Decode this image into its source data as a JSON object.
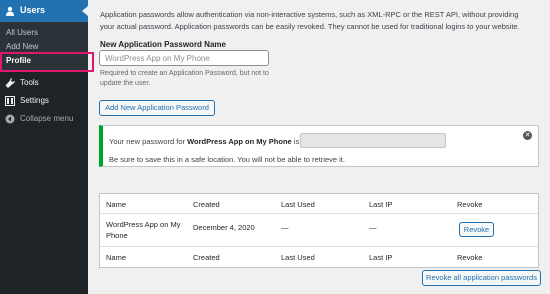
{
  "sidebar": {
    "users_label": "Users",
    "submenu": [
      "All Users",
      "Add New",
      "Profile"
    ],
    "tools_label": "Tools",
    "settings_label": "Settings",
    "collapse_label": "Collapse menu"
  },
  "intro_text": "Application passwords allow authentication via non-interactive systems, such as XML-RPC or the REST API, without providing your actual password. Application passwords can be easily revoked. They cannot be used for traditional logins to your website.",
  "new_password": {
    "label": "New Application Password Name",
    "placeholder": "WordPress App on My Phone",
    "value": "",
    "hint": "Required to create an Application Password, but not to update the user.",
    "add_button": "Add New Application Password"
  },
  "notice": {
    "prefix": "Your new password for ",
    "app_name": "WordPress App on My Phone",
    "suffix": " is:",
    "warning": "Be sure to save this in a safe location. You will not be able to retrieve it.",
    "dismiss_glyph": "✕"
  },
  "table": {
    "columns": [
      "Name",
      "Created",
      "Last Used",
      "Last IP",
      "Revoke"
    ],
    "rows": [
      {
        "name": "WordPress App on My Phone",
        "created": "December 4, 2020",
        "last_used": "—",
        "last_ip": "—",
        "revoke_label": "Revoke"
      }
    ]
  },
  "revoke_all_button": "Revoke all application passwords",
  "colors": {
    "sidebar_bg": "#1d2327",
    "accent": "#2271b1",
    "notice_success": "#00a32a",
    "highlight": "#e0166f"
  }
}
